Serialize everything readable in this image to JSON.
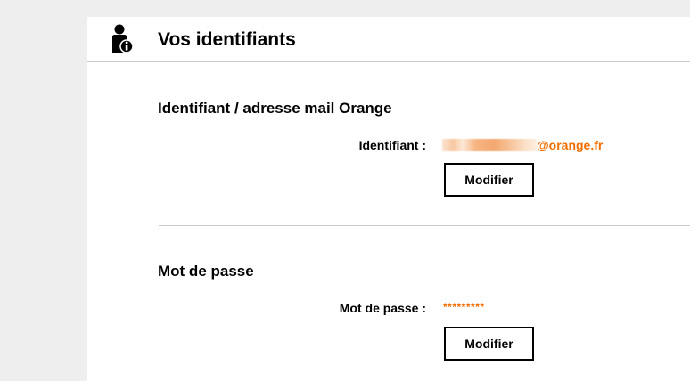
{
  "header": {
    "title": "Vos identifiants",
    "icon": "user-info-icon"
  },
  "identifier_section": {
    "title": "Identifiant / adresse mail Orange",
    "label": "Identifiant :",
    "value_domain": "@orange.fr",
    "button_label": "Modifier"
  },
  "password_section": {
    "title": "Mot de passe",
    "label": "Mot de passe :",
    "value": "*********",
    "button_label": "Modifier"
  },
  "colors": {
    "accent": "#f16e00",
    "background": "#eeeeee",
    "card": "#ffffff",
    "divider": "#cccccc"
  }
}
